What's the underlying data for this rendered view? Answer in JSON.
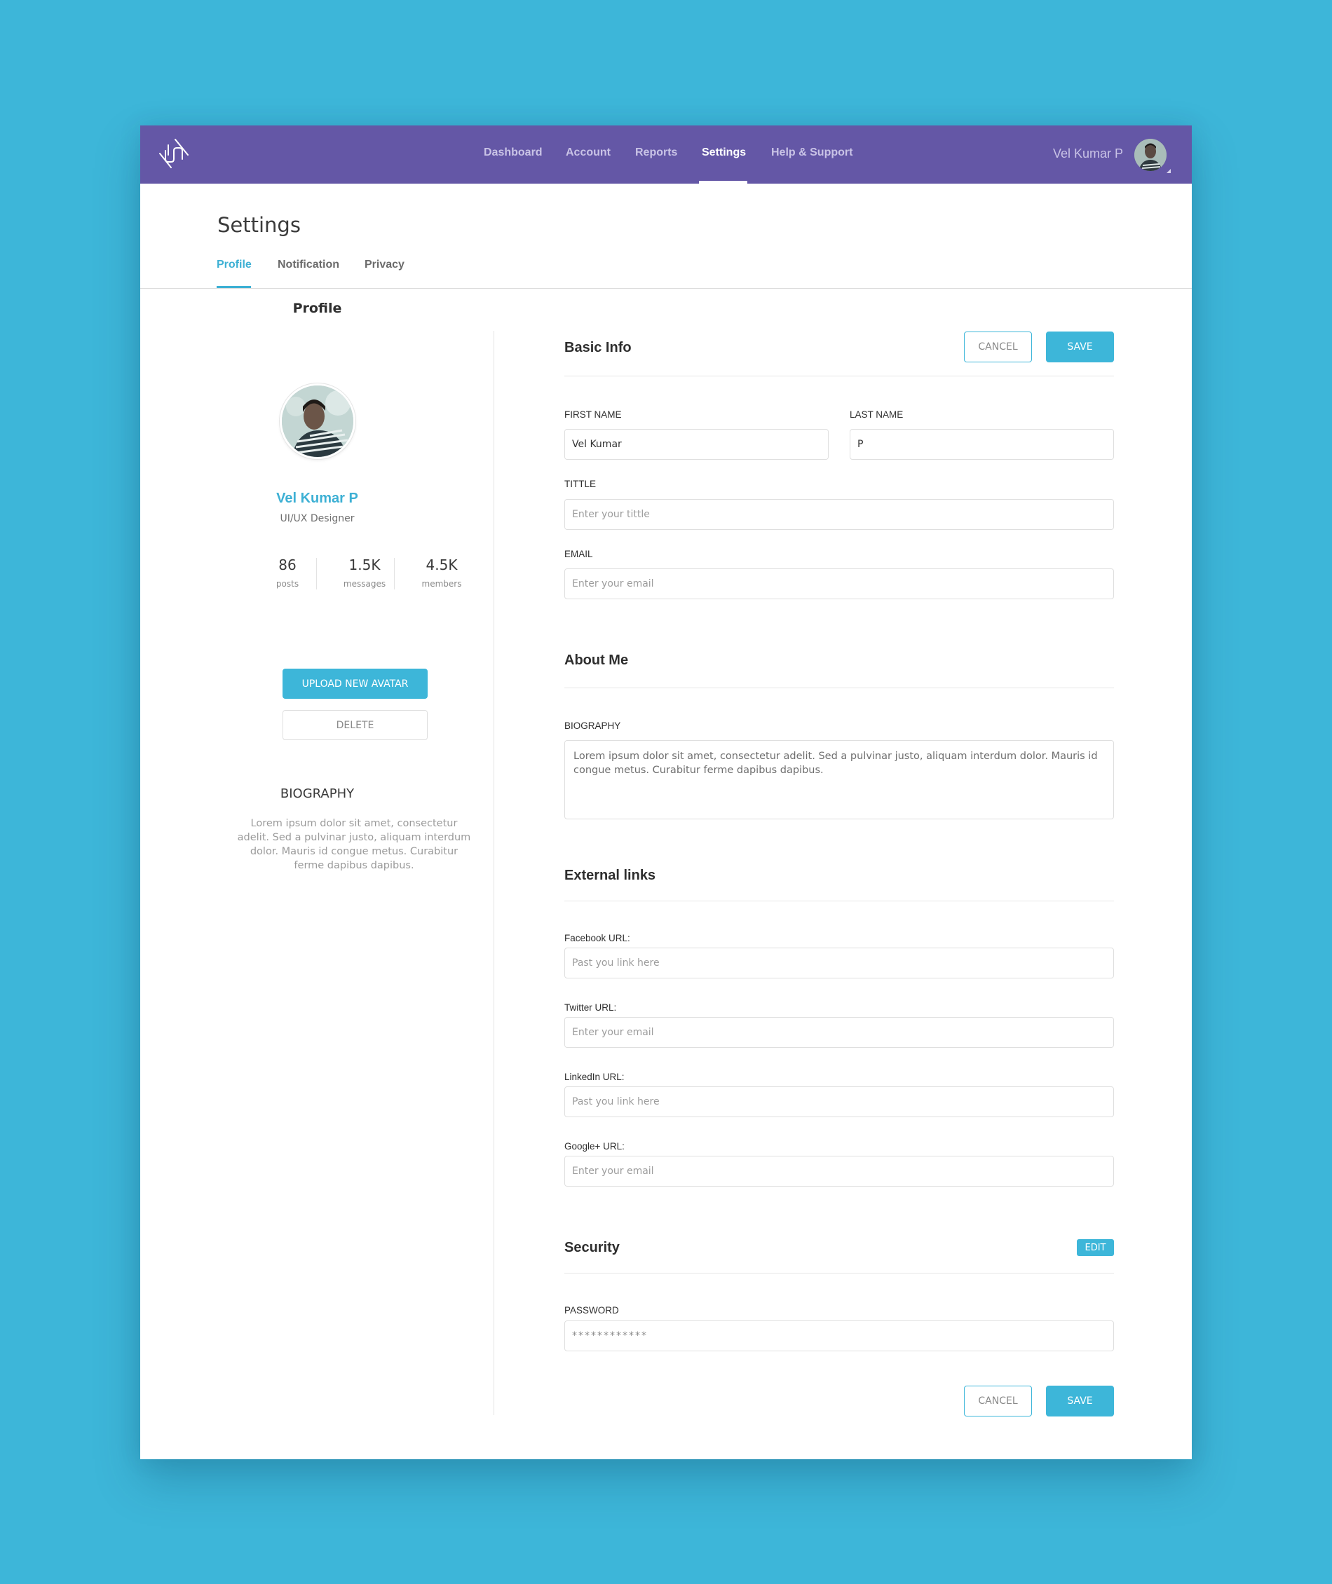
{
  "colors": {
    "background": "#3db6d9",
    "navbar": "#6457a6",
    "accent": "#3db6d9",
    "accent_text": "#3db0d4"
  },
  "navbar": {
    "logo": "brand-logo-icon",
    "links": [
      {
        "label": "Dashboard",
        "active": false
      },
      {
        "label": "Account",
        "active": false
      },
      {
        "label": "Reports",
        "active": false
      },
      {
        "label": "Settings",
        "active": true
      },
      {
        "label": "Help & Support",
        "active": false
      }
    ],
    "user_name": "Vel Kumar P",
    "avatar": "user-avatar"
  },
  "page": {
    "title": "Settings",
    "tabs": [
      {
        "label": "Profile",
        "active": true
      },
      {
        "label": "Notification",
        "active": false
      },
      {
        "label": "Privacy",
        "active": false
      }
    ]
  },
  "profile_card": {
    "heading": "Profile",
    "name": "Vel Kumar P",
    "role": "UI/UX Designer",
    "stats": [
      {
        "value": "86",
        "label": "posts"
      },
      {
        "value": "1.5K",
        "label": "messages"
      },
      {
        "value": "4.5K",
        "label": "members"
      }
    ],
    "upload_button": "UPLOAD NEW AVATAR",
    "delete_button": "DELETE",
    "bio_heading": "BIOGRAPHY",
    "bio_text": "Lorem ipsum dolor sit amet, consectetur adelit. Sed a pulvinar justo, aliquam interdum dolor. Mauris id congue metus. Curabitur ferme dapibus dapibus."
  },
  "basic_info": {
    "title": "Basic Info",
    "cancel_label": "CANCEL",
    "save_label": "SAVE",
    "first_name": {
      "label": "FIRST NAME",
      "value": "Vel Kumar",
      "placeholder": ""
    },
    "last_name": {
      "label": "LAST NAME",
      "value": "P",
      "placeholder": ""
    },
    "title_field": {
      "label": "TITTLE",
      "value": "",
      "placeholder": "Enter your tittle"
    },
    "email": {
      "label": "EMAIL",
      "value": "",
      "placeholder": "Enter your email"
    }
  },
  "about_me": {
    "title": "About Me",
    "biography": {
      "label": "BIOGRAPHY",
      "value": "Lorem ipsum dolor sit amet, consectetur adelit. Sed a pulvinar justo, aliquam interdum dolor. Mauris id congue metus. Curabitur ferme dapibus dapibus."
    }
  },
  "external_links": {
    "title": "External links",
    "facebook": {
      "label": "Facebook URL:",
      "value": "",
      "placeholder": "Past you link here"
    },
    "twitter": {
      "label": "Twitter URL:",
      "value": "",
      "placeholder": "Enter your email"
    },
    "linkedin": {
      "label": "LinkedIn URL:",
      "value": "",
      "placeholder": "Past you link here"
    },
    "googleplus": {
      "label": "Google+ URL:",
      "value": "",
      "placeholder": "Enter your email"
    }
  },
  "security": {
    "title": "Security",
    "edit_label": "EDIT",
    "password": {
      "label": "PASSWORD",
      "value": "************"
    }
  },
  "footer_actions": {
    "cancel_label": "CANCEL",
    "save_label": "SAVE"
  }
}
